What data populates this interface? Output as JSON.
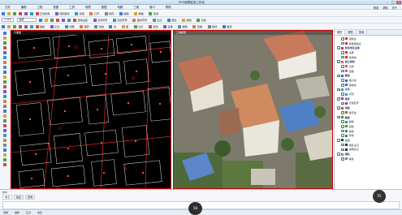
{
  "app": {
    "title": "EPS地理信息工作站"
  },
  "menus": [
    "文件",
    "编辑",
    "工程",
    "视图",
    "工具",
    "地理",
    "数据",
    "地籍",
    "三维",
    "窗口",
    "帮助"
  ],
  "menu_right": [
    "登录",
    "帮助",
    "关于"
  ],
  "toolbar1": {
    "items": [
      "正射影像",
      "倾斜摄影",
      "新建",
      "打开",
      "保存",
      "撤销",
      "重做",
      "查询"
    ]
  },
  "toolbar2": {
    "combo1": "1:500",
    "combo2": "图层",
    "items": [
      "通用设置",
      "点状符号",
      "线状符号",
      "面状符号",
      "注记",
      "属性",
      "编辑",
      "对象"
    ]
  },
  "toolbar3": {
    "items": [
      "捕捉",
      "正交",
      "测量",
      "裁剪",
      "绘制",
      "线",
      "面",
      "注记",
      "查询",
      "选择",
      "删除",
      "复制",
      "移动",
      "旋转"
    ]
  },
  "left_pane": {
    "header": "平面图"
  },
  "right_pane": {
    "header": "三维模型"
  },
  "side_panel": {
    "tabs": [
      "图层",
      "属性",
      "查询"
    ],
    "layers": [
      {
        "label": "控制点",
        "group": false,
        "color": "#d33"
      },
      {
        "label": "测量控制点",
        "group": false,
        "color": "#d33"
      },
      {
        "label": "居民地及设施",
        "group": true,
        "color": "#d33"
      },
      {
        "label": "房屋",
        "group": false,
        "color": "#d33"
      },
      {
        "label": "建筑物",
        "group": false,
        "color": "#d33"
      },
      {
        "label": "独立地物",
        "group": true,
        "color": "#c66"
      },
      {
        "label": "交通",
        "group": false,
        "color": "#c66"
      },
      {
        "label": "道路",
        "group": false,
        "color": "#c66"
      },
      {
        "label": "管线",
        "group": true,
        "color": "#36c"
      },
      {
        "label": "电力线",
        "group": false,
        "color": "#36c"
      },
      {
        "label": "通信线",
        "group": false,
        "color": "#36c"
      },
      {
        "label": "水系",
        "group": true,
        "color": "#39c"
      },
      {
        "label": "河流",
        "group": false,
        "color": "#39c"
      },
      {
        "label": "境界",
        "group": true,
        "color": "#a3a"
      },
      {
        "label": "行政区界",
        "group": false,
        "color": "#a3a"
      },
      {
        "label": "地貌",
        "group": true,
        "color": "#963"
      },
      {
        "label": "等高线",
        "group": false,
        "color": "#963"
      },
      {
        "label": "植被",
        "group": true,
        "color": "#393"
      },
      {
        "label": "耕地",
        "group": false,
        "color": "#393"
      },
      {
        "label": "园地",
        "group": false,
        "color": "#393"
      },
      {
        "label": "林地",
        "group": false,
        "color": "#393"
      },
      {
        "label": "草地",
        "group": false,
        "color": "#393"
      },
      {
        "label": "注记",
        "group": true,
        "color": "#333"
      },
      {
        "label": "地名注记",
        "group": false,
        "color": "#333"
      },
      {
        "label": "说明注记",
        "group": false,
        "color": "#333"
      },
      {
        "label": "辅助",
        "group": true,
        "color": "#888"
      },
      {
        "label": "其他",
        "group": false,
        "color": "#888"
      }
    ]
  },
  "bottom": {
    "label": "命令",
    "tabs": [
      "命令",
      "输出",
      "查询"
    ]
  },
  "status": {
    "items": [
      "就绪",
      "捕捉",
      "正交",
      "坐标"
    ],
    "fps_left": "58",
    "fps_right": "55"
  }
}
